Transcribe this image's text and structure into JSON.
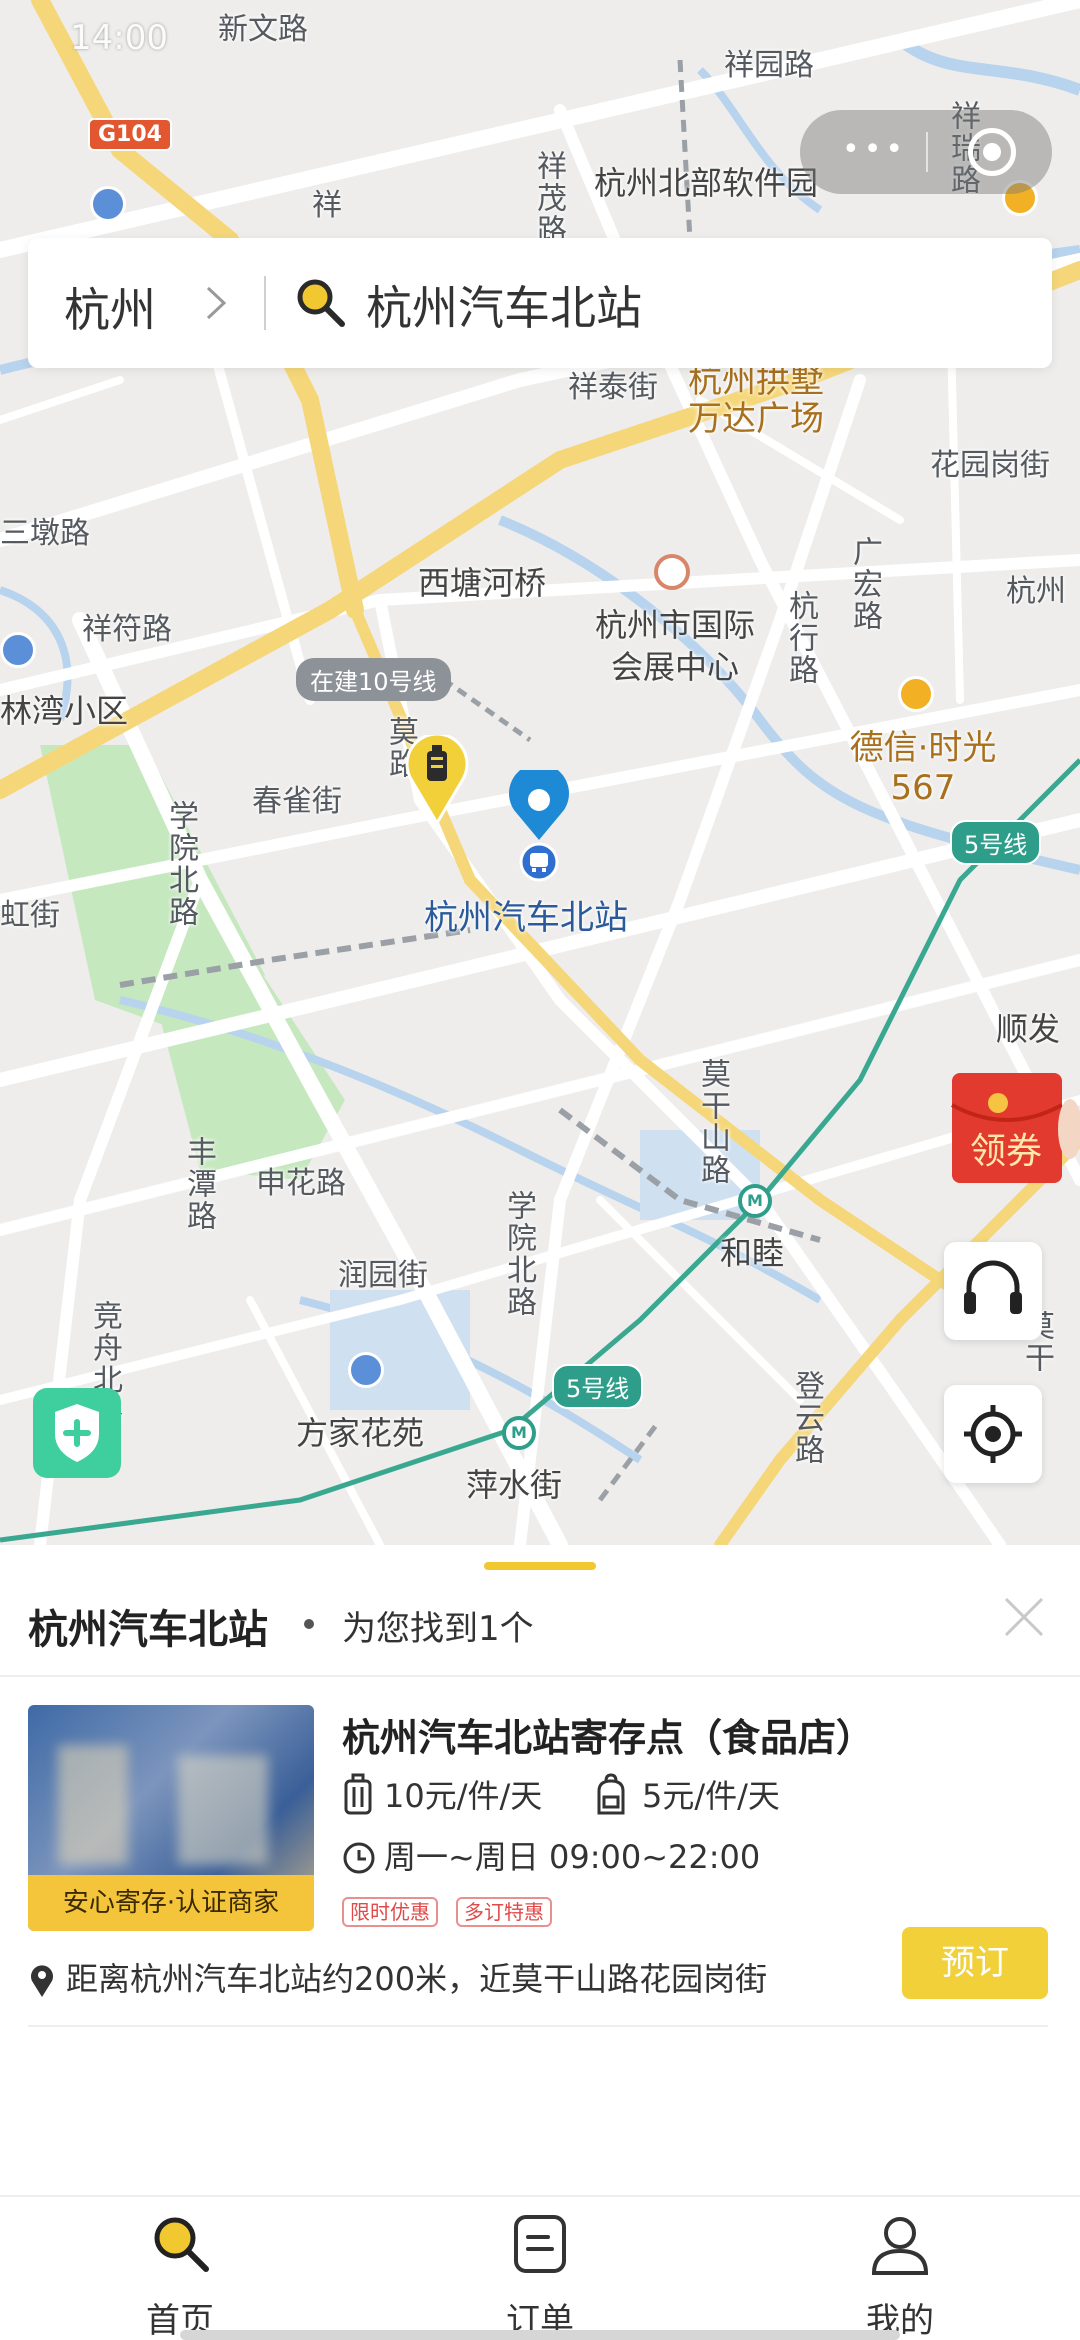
{
  "status_bar": {
    "time": "14:00"
  },
  "search": {
    "city": "杭州",
    "query": "杭州汽车北站"
  },
  "map": {
    "labels": {
      "xinwen_road": "新文路",
      "xiangyuan_road": "祥园路",
      "north_software_park": "杭州北部软件园",
      "xiangrui_road": "祥瑞路",
      "xiang_partial": "祥",
      "xiangmao_road": "祥茂路",
      "xiangtai_street": "祥泰街",
      "gongshu_wanda": "杭州拱墅万达广场",
      "huayuangang_street": "花园岗街",
      "hangzhou_partial": "杭州",
      "sandun_road": "三墩路",
      "xitanghe_bridge": "西塘河桥",
      "hz_expo_center": "杭州市国际会展中心",
      "guanghong_road": "广宏路",
      "xiangfu_road": "祥符路",
      "hangxing_road": "杭行路",
      "linwan_community": "林湾小区",
      "dexin_567": "德信·时光567",
      "chunque_street": "春雀街",
      "mo_road": "莫路",
      "xueyuan_north_road_1": "学院北路",
      "station_label": "杭州汽车北站",
      "hong_street": "虹街",
      "shunfa": "顺发",
      "fengtan_road": "丰潭路",
      "shenhua_road": "申花路",
      "moganshan_road": "莫干山路",
      "xueyuan_north_road_2": "学院北路",
      "hemu": "和睦",
      "runyuan_street": "润园街",
      "jingzhou_north_road": "竞舟北路",
      "fangjia_huayuan": "方家花苑",
      "pingshui_street": "萍水街",
      "dengyun_road": "登云路",
      "mogan_partial": "莫干"
    },
    "badges": {
      "g104": "G104",
      "line10_construction": "在建10号线",
      "line5_a": "5号线",
      "line5_b": "5号线"
    },
    "coupon_label": "领券"
  },
  "sheet": {
    "title": "杭州汽车北站",
    "found_text": "为您找到1个",
    "store": {
      "name": "杭州汽车北站寄存点（食品店）",
      "badge": "安心寄存·认证商家",
      "price_luggage": "10元/件/天",
      "price_backpack": "5元/件/天",
      "hours": "周一~周日 09:00~22:00",
      "tags": [
        "限时优惠",
        "多订特惠"
      ],
      "distance": "距离杭州汽车北站约200米，近莫干山路花园岗街",
      "book_label": "预订"
    }
  },
  "tabs": [
    {
      "label": "首页",
      "icon": "search-icon",
      "active": true
    },
    {
      "label": "订单",
      "icon": "order-icon",
      "active": false
    },
    {
      "label": "我的",
      "icon": "user-icon",
      "active": false
    }
  ],
  "colors": {
    "accent": "#f2d03a",
    "map_bg": "#eeedeb",
    "water": "#b7d3ee",
    "park": "#c6e8bf",
    "metro": "#2e9e8a",
    "highway": "#f5d77a",
    "pin_blue": "#1e8ad6"
  }
}
